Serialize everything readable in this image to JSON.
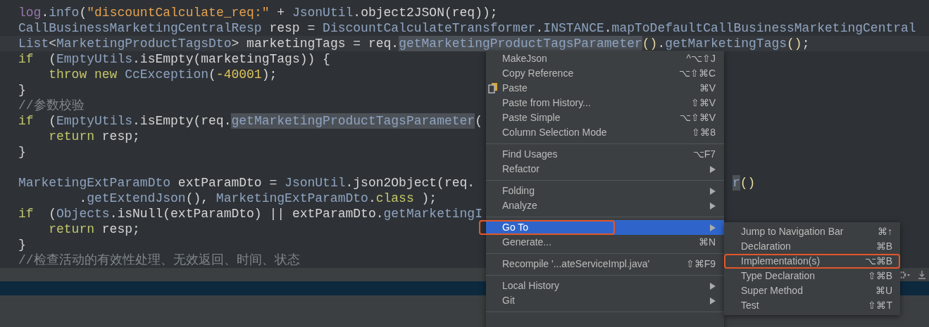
{
  "editor": {
    "lines": [
      {
        "current": false,
        "tokens": [
          {
            "kind": "field",
            "text": "log"
          },
          {
            "kind": "plain",
            "text": "."
          },
          {
            "kind": "method",
            "text": "info"
          },
          {
            "kind": "plain",
            "text": "("
          },
          {
            "kind": "string",
            "text": "\"discountCalculate_req:\""
          },
          {
            "kind": "plain",
            "text": " + "
          },
          {
            "kind": "type",
            "text": "JsonUtil"
          },
          {
            "kind": "plain",
            "text": ".object2JSON(req));"
          }
        ]
      },
      {
        "current": false,
        "tokens": [
          {
            "kind": "type",
            "text": "CallBusinessMarketingCentralResp"
          },
          {
            "kind": "plain",
            "text": " resp = "
          },
          {
            "kind": "type",
            "text": "DiscountCalculateTransformer"
          },
          {
            "kind": "plain",
            "text": "."
          },
          {
            "kind": "type",
            "text": "INSTANCE"
          },
          {
            "kind": "plain",
            "text": "."
          },
          {
            "kind": "method",
            "text": "mapToDefaultCallBusinessMarketingCentral"
          }
        ]
      },
      {
        "current": true,
        "tokens": [
          {
            "kind": "type",
            "text": "List"
          },
          {
            "kind": "plain",
            "text": "<"
          },
          {
            "kind": "type",
            "text": "MarketingProductTagsDto"
          },
          {
            "kind": "plain",
            "text": "> marketingTags = req."
          },
          {
            "kind": "usage",
            "text": "getMarketingProductTagsParameter"
          },
          {
            "kind": "paren",
            "text": "()"
          },
          {
            "kind": "plain",
            "text": "."
          },
          {
            "kind": "method",
            "text": "getMarketingTags"
          },
          {
            "kind": "paren",
            "text": "()"
          },
          {
            "kind": "plain",
            "text": ";"
          }
        ]
      },
      {
        "current": false,
        "tokens": [
          {
            "kind": "keyword",
            "text": "if"
          },
          {
            "kind": "plain",
            "text": " ("
          },
          {
            "kind": "type",
            "text": "EmptyUtils"
          },
          {
            "kind": "plain",
            "text": ".isEmpty(marketingTags)) {"
          }
        ],
        "children": [
          {
            "current": false,
            "tokens": [
              {
                "kind": "keyword",
                "text": "throw new"
              },
              {
                "kind": "type",
                "text": "CcException"
              },
              {
                "kind": "plain",
                "text": "("
              },
              {
                "kind": "number",
                "text": "-40001"
              },
              {
                "kind": "plain",
                "text": ");"
              }
            ]
          }
        ]
      },
      {
        "current": false,
        "tokens": [
          {
            "kind": "plain",
            "text": "}"
          }
        ]
      },
      {
        "current": false,
        "tokens": [
          {
            "kind": "comment",
            "text": "//参数校验"
          }
        ]
      },
      {
        "current": false,
        "tokens": [
          {
            "kind": "keyword",
            "text": "if"
          },
          {
            "kind": "plain",
            "text": " ("
          },
          {
            "kind": "type",
            "text": "EmptyUtils"
          },
          {
            "kind": "plain",
            "text": ".isEmpty(req."
          },
          {
            "kind": "usage",
            "text": "getMarketingProductTagsParameter"
          },
          {
            "kind": "plain",
            "text": "("
          }
        ],
        "children": [
          {
            "current": false,
            "tokens": [
              {
                "kind": "keyword",
                "text": "return"
              },
              {
                "kind": "plain",
                "text": "resp;"
              }
            ]
          }
        ]
      },
      {
        "current": false,
        "tokens": [
          {
            "kind": "plain",
            "text": "}"
          }
        ]
      },
      {
        "current": false
      },
      {
        "current": false,
        "tokens": [
          {
            "kind": "type",
            "text": "MarketingExtParamDto"
          },
          {
            "kind": "plain",
            "text": " extParamDto = "
          },
          {
            "kind": "type",
            "text": "JsonUtil"
          },
          {
            "kind": "plain",
            "text": ".json2Object(req."
          }
        ],
        "after_menu": [
          {
            "kind": "usage",
            "text": "r"
          },
          {
            "kind": "paren",
            "text": "()"
          }
        ],
        "children": [
          {
            "current": false,
            "kind": "continuation",
            "tokens": [
              {
                "kind": "plain",
                "text": "."
              },
              {
                "kind": "method",
                "text": "getExtendJson"
              },
              {
                "kind": "plain",
                "text": "(), "
              },
              {
                "kind": "type",
                "text": "MarketingExtParamDto"
              },
              {
                "kind": "plain",
                "text": "."
              },
              {
                "kind": "keyword",
                "text": "class"
              },
              {
                "kind": "plain",
                "text": ");"
              }
            ]
          }
        ]
      },
      {
        "current": false,
        "tokens": [
          {
            "kind": "keyword",
            "text": "if"
          },
          {
            "kind": "plain",
            "text": " ("
          },
          {
            "kind": "type",
            "text": "Objects"
          },
          {
            "kind": "plain",
            "text": ".isNull(extParamDto) || extParamDto."
          },
          {
            "kind": "method",
            "text": "getMarketingI"
          }
        ],
        "children": [
          {
            "current": false,
            "tokens": [
              {
                "kind": "keyword",
                "text": "return"
              },
              {
                "kind": "plain",
                "text": "resp;"
              }
            ]
          }
        ]
      },
      {
        "current": false,
        "tokens": [
          {
            "kind": "plain",
            "text": "}"
          }
        ]
      },
      {
        "current": false,
        "tokens": [
          {
            "kind": "comment",
            "text": "//检查活动的有效性处理、无效返回、时间、状态"
          }
        ]
      }
    ]
  },
  "context_menu": {
    "items": [
      {
        "kind": "item",
        "label": "MakeJson",
        "shortcut": "^⌥⇧J",
        "submenu": false,
        "selected": false,
        "outlined": false
      },
      {
        "kind": "item",
        "label": "Copy Reference",
        "shortcut": "⌥⇧⌘C",
        "submenu": false,
        "selected": false,
        "outlined": false
      },
      {
        "kind": "icon_item",
        "label": "Paste",
        "shortcut": "⌘V",
        "submenu": false,
        "selected": false,
        "outlined": false
      },
      {
        "kind": "item",
        "label": "Paste from History...",
        "shortcut": "⇧⌘V",
        "submenu": false,
        "selected": false,
        "outlined": false
      },
      {
        "kind": "item",
        "label": "Paste Simple",
        "shortcut": "⌥⇧⌘V",
        "submenu": false,
        "selected": false,
        "outlined": false
      },
      {
        "kind": "item",
        "label": "Column Selection Mode",
        "shortcut": "⇧⌘8",
        "submenu": false,
        "selected": false,
        "outlined": false
      },
      {
        "kind": "separator"
      },
      {
        "kind": "item",
        "label": "Find Usages",
        "shortcut": "⌥F7",
        "submenu": false,
        "selected": false,
        "outlined": false
      },
      {
        "kind": "item",
        "label": "Refactor",
        "submenu": true,
        "selected": false,
        "outlined": false
      },
      {
        "kind": "separator"
      },
      {
        "kind": "item",
        "label": "Folding",
        "submenu": true,
        "selected": false,
        "outlined": false
      },
      {
        "kind": "item",
        "label": "Analyze",
        "submenu": true,
        "selected": false,
        "outlined": false
      },
      {
        "kind": "separator"
      },
      {
        "kind": "item",
        "label": "Go To",
        "submenu": true,
        "selected": true,
        "outlined": true
      },
      {
        "kind": "item",
        "label": "Generate...",
        "shortcut": "⌘N",
        "submenu": false,
        "selected": false,
        "outlined": false
      },
      {
        "kind": "separator"
      },
      {
        "kind": "item",
        "label": "Recompile '...ateServiceImpl.java'",
        "shortcut": "⇧⌘F9",
        "submenu": false,
        "selected": false,
        "outlined": false
      },
      {
        "kind": "separator"
      },
      {
        "kind": "item",
        "label": "Local History",
        "submenu": true,
        "selected": false,
        "outlined": false
      },
      {
        "kind": "item",
        "label": "Git",
        "submenu": true,
        "selected": false,
        "outlined": false
      },
      {
        "kind": "separator"
      }
    ]
  },
  "submenu": {
    "items": [
      {
        "label": "Jump to Navigation Bar",
        "shortcut": "⌘↑",
        "selected": false,
        "outlined": false
      },
      {
        "label": "Declaration",
        "shortcut": "⌘B",
        "selected": false,
        "outlined": false
      },
      {
        "label": "Implementation(s)",
        "shortcut": "⌥⌘B",
        "selected": false,
        "outlined": true
      },
      {
        "label": "Type Declaration",
        "shortcut": "⇧⌘B",
        "selected": false,
        "outlined": false
      },
      {
        "label": "Super Method",
        "shortcut": "⌘U",
        "selected": false,
        "outlined": false
      },
      {
        "label": "Test",
        "shortcut": "⇧⌘T",
        "selected": false,
        "outlined": false
      }
    ]
  }
}
